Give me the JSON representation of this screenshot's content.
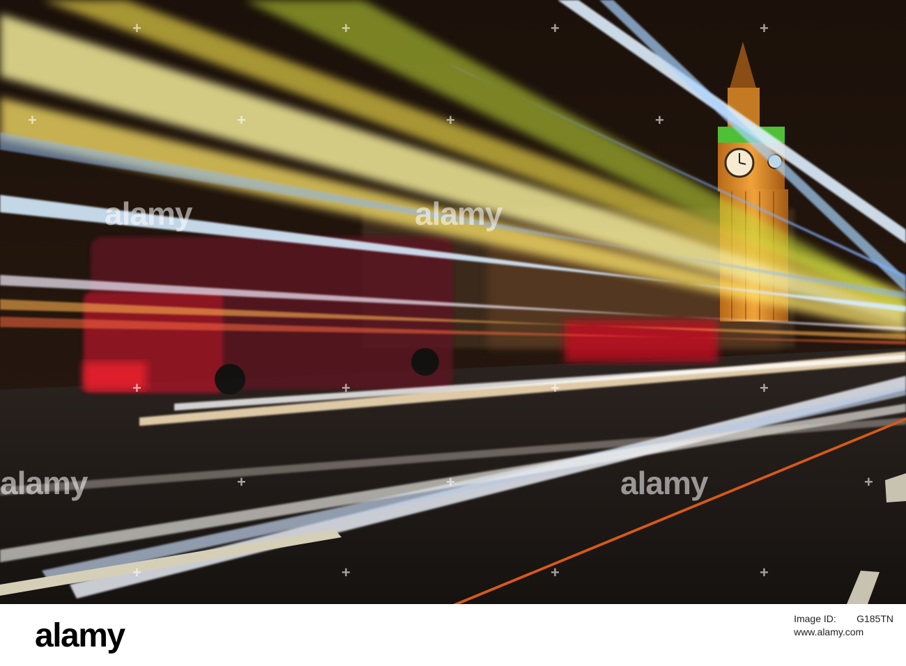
{
  "photo": {
    "subject": "Big Ben / Houses of Parliament at night",
    "colors": {
      "sky": "#1e120a",
      "tower": "#d88a2a",
      "clock_glow": "#5ad13a",
      "road": "#26201c",
      "bus_red": "#b01020"
    }
  },
  "watermarks": {
    "text": "alamy",
    "plus": "+"
  },
  "footer": {
    "brand": "alamy",
    "image_id_label": "Image ID:",
    "image_id": "G185TN",
    "url": "www.alamy.com"
  }
}
